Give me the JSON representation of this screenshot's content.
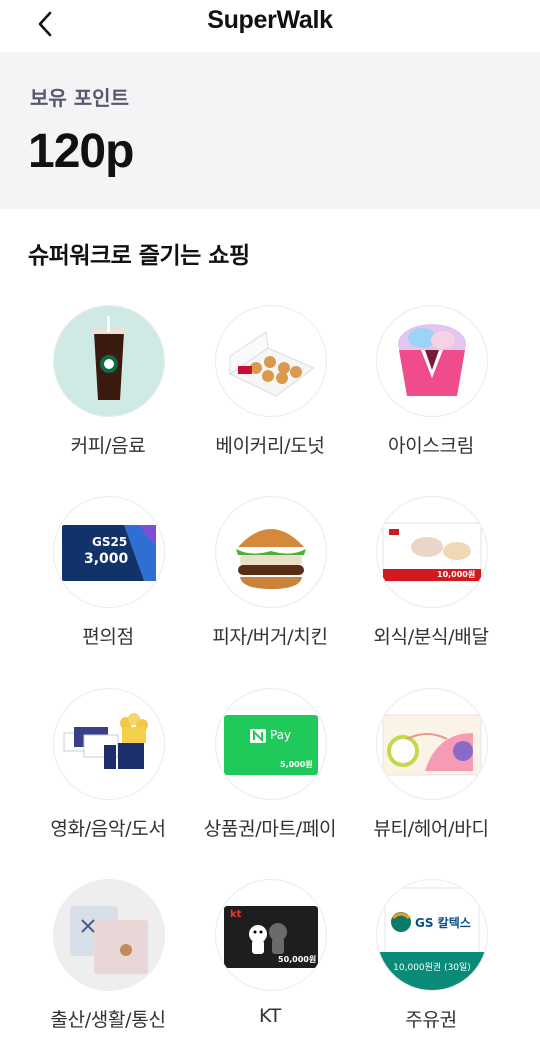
{
  "header": {
    "title": "SuperWalk",
    "back_icon": "chevron-left-icon"
  },
  "points": {
    "label": "보유 포인트",
    "value": "120p"
  },
  "shopping": {
    "title": "슈퍼워크로 즐기는 쇼핑",
    "categories": [
      {
        "label": "커피/음료",
        "icon": "coffee-icon"
      },
      {
        "label": "베이커리/도넛",
        "icon": "donut-box-icon"
      },
      {
        "label": "아이스크림",
        "icon": "ice-cream-icon"
      },
      {
        "label": "편의점",
        "icon": "gs25-voucher-icon",
        "card_brand": "GS25",
        "card_amount": "3,000"
      },
      {
        "label": "피자/버거/치킨",
        "icon": "burger-icon"
      },
      {
        "label": "외식/분식/배달",
        "icon": "restaurant-voucher-icon",
        "card_amount": "10,000원"
      },
      {
        "label": "영화/음악/도서",
        "icon": "movie-tickets-icon"
      },
      {
        "label": "상품권/마트/페이",
        "icon": "naver-pay-card-icon",
        "card_brand": "Pay",
        "card_amount": "5,000원"
      },
      {
        "label": "뷰티/헤어/바디",
        "icon": "beauty-voucher-icon"
      },
      {
        "label": "출산/생활/통신",
        "icon": "towel-set-icon"
      },
      {
        "label": "KT",
        "icon": "kt-card-icon",
        "card_brand": "kt",
        "card_amount": "50,000원"
      },
      {
        "label": "주유권",
        "icon": "gs-caltex-voucher-icon",
        "card_brand": "GS 칼텍스",
        "card_amount": "10,000원권 (30일)"
      }
    ]
  }
}
